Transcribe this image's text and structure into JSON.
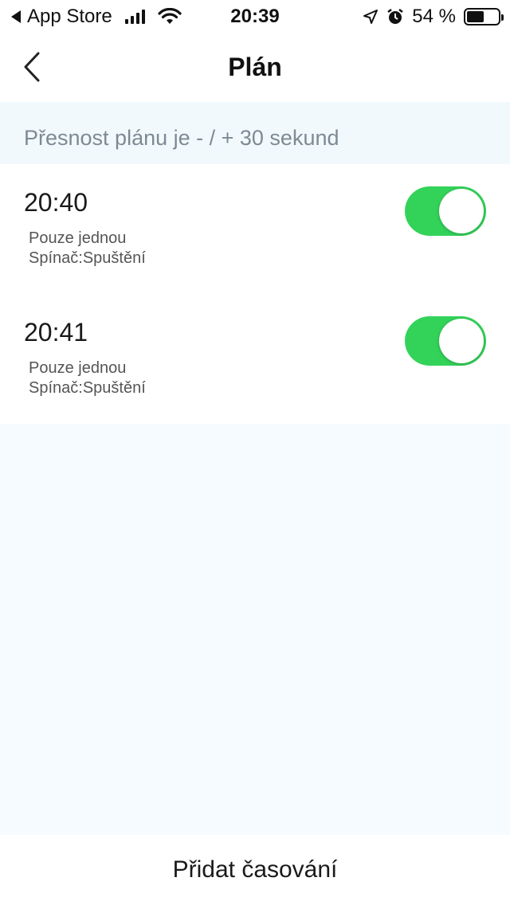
{
  "status_bar": {
    "back_app": "App Store",
    "time": "20:39",
    "battery": "54 %",
    "battery_level": 0.54,
    "icons": [
      "back-triangle-icon",
      "signal-icon",
      "wifi-icon",
      "location-arrow-icon",
      "alarm-icon",
      "battery-icon"
    ]
  },
  "header": {
    "title": "Plán",
    "back_icon": "chevron-left-icon"
  },
  "notice": {
    "text": "Přesnost plánu je - / + 30 sekund"
  },
  "schedules": [
    {
      "time": "20:40",
      "repeat": "Pouze jednou",
      "action": "Spínač:Spuštění",
      "enabled": true
    },
    {
      "time": "20:41",
      "repeat": "Pouze jednou",
      "action": "Spínač:Spuštění",
      "enabled": true
    }
  ],
  "footer": {
    "add_label": "Přidat časování"
  },
  "colors": {
    "toggle_on": "#33d35a",
    "background": "#f5fbfe",
    "notice_text": "#7d8a94"
  }
}
